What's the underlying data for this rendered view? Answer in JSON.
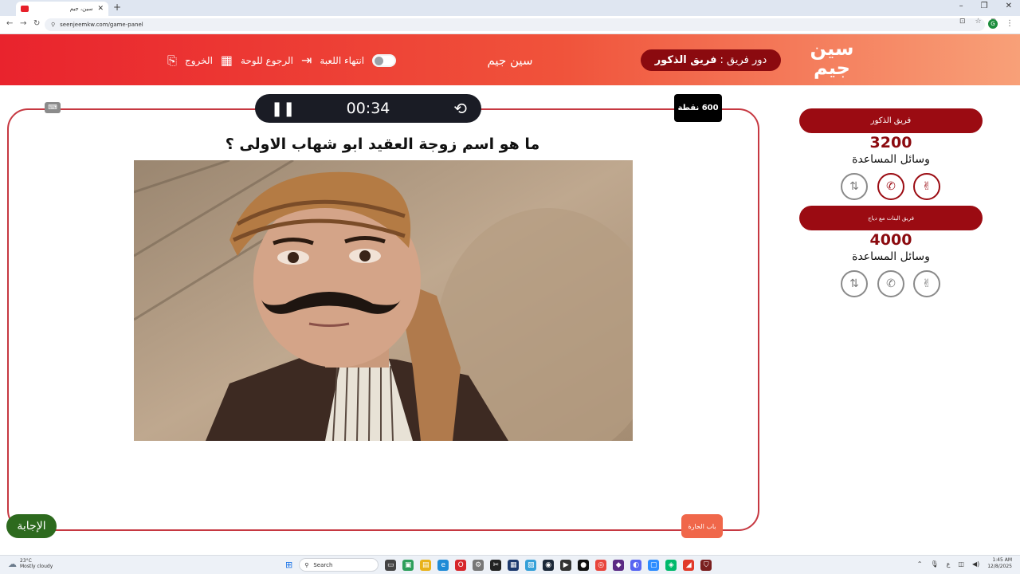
{
  "browser": {
    "tab_title": "سين، جيم",
    "new_tab": "+",
    "url": "seenjeemkw.com/game-panel",
    "window_controls": [
      "–",
      "❐",
      "✕"
    ]
  },
  "header": {
    "logo_text": "سين جيم",
    "turn_prefix": "دور فريق :",
    "turn_team": "فريق الذكور",
    "site_name": "سين جيم",
    "end_game": "انتهاء اللعبة",
    "back_to_board": "الرجوع للوحة",
    "exit": "الخروج"
  },
  "game": {
    "timer": "00:34",
    "points": "600 نقطة",
    "question": "ما هو اسم زوجة العقيد ابو شهاب الاولى ؟",
    "answer_button": "الإجابة",
    "door_button": "باب الحارة"
  },
  "teams": [
    {
      "name": "فريق الذكور",
      "score": "3200",
      "aids_label": "وسائل المساعدة",
      "aids": [
        {
          "icon": "hand-peace-icon",
          "active": true
        },
        {
          "icon": "phone-icon",
          "active": true
        },
        {
          "icon": "swap-icon",
          "active": false
        }
      ]
    },
    {
      "name": "فريق البنات مع دياج",
      "score": "4000",
      "aids_label": "وسائل المساعدة",
      "aids": [
        {
          "icon": "hand-peace-icon",
          "active": false
        },
        {
          "icon": "phone-icon",
          "active": false
        },
        {
          "icon": "swap-icon",
          "active": false
        }
      ]
    }
  ],
  "taskbar": {
    "temperature": "23°C",
    "weather": "Mostly cloudy",
    "search_placeholder": "Search",
    "time": "1:45 AM",
    "date": "12/8/2025"
  },
  "colors": {
    "header_start": "#e9232d",
    "header_end": "#f8a078",
    "team_pill": "#9b0b12",
    "answer_green": "#2d6a1e",
    "board_border": "#c63841"
  }
}
